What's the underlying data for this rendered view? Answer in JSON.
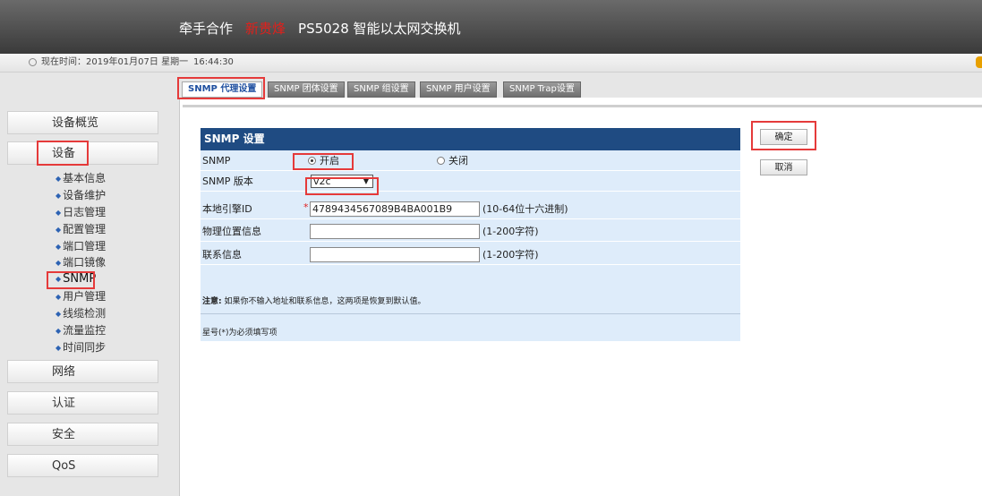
{
  "header": {
    "brand_partner": "牵手合作",
    "brand_name": "新贵烽",
    "title": "PS5028 智能以太网交换机"
  },
  "timebar": {
    "label": "现在时间：2019年01月07日  星期一",
    "clock": "16:44:30"
  },
  "sidebar": {
    "top": [
      "设备概览",
      "设备"
    ],
    "sub_items": [
      "基本信息",
      "设备维护",
      "日志管理",
      "配置管理",
      "端口管理",
      "端口镜像",
      "SNMP",
      "用户管理",
      "线缆检测",
      "流量监控",
      "时间同步"
    ],
    "active_sub": "SNMP",
    "bottom": [
      "网络",
      "认证",
      "安全",
      "QoS"
    ]
  },
  "tabs": [
    "SNMP 代理设置",
    "SNMP 团体设置",
    "SNMP 组设置",
    "SNMP 用户设置",
    "SNMP Trap设置"
  ],
  "panel": {
    "title": "SNMP 设置",
    "snmp_label": "SNMP",
    "on_label": "开启",
    "off_label": "关闭",
    "version_label": "SNMP 版本",
    "version_value": "v2c",
    "engine_label": "本地引擎ID",
    "engine_value": "4789434567089B4BA001B9",
    "engine_hint": "(10-64位十六进制)",
    "location_label": "物理位置信息",
    "location_hint": "(1-200字符)",
    "contact_label": "联系信息",
    "contact_hint": "(1-200字符)",
    "note_prefix": "注意:",
    "note_text": " 如果你不输入地址和联系信息，这两项是恢复到默认值。",
    "required_note": "星号(*)为必须填写项"
  },
  "buttons": {
    "ok": "确定",
    "cancel": "取消"
  }
}
